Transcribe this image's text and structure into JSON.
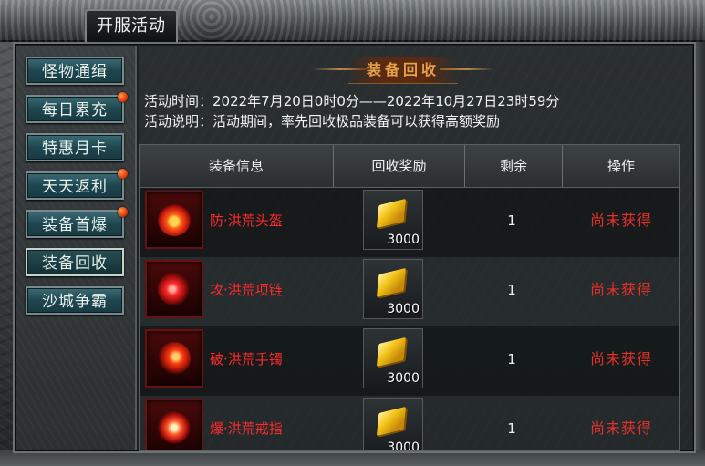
{
  "window": {
    "title": "开服活动"
  },
  "sidebar": {
    "items": [
      {
        "label": "怪物通缉",
        "badge": false,
        "active": false
      },
      {
        "label": "每日累充",
        "badge": true,
        "active": false
      },
      {
        "label": "特惠月卡",
        "badge": false,
        "active": false
      },
      {
        "label": "天天返利",
        "badge": true,
        "active": false
      },
      {
        "label": "装备首爆",
        "badge": true,
        "active": false
      },
      {
        "label": "装备回收",
        "badge": false,
        "active": true
      },
      {
        "label": "沙城争霸",
        "badge": false,
        "active": false
      }
    ]
  },
  "main": {
    "banner_title": "装备回收",
    "time_line": "活动时间：2022年7月20日0时0分——2022年10月27日23时59分",
    "desc_line": "活动说明：活动期间，率先回收极品装备可以获得高额奖励",
    "table": {
      "headers": [
        "装备信息",
        "回收奖励",
        "剩余",
        "操作"
      ],
      "rows": [
        {
          "name": "防·洪荒头盔",
          "icon": "helmet-icon",
          "reward": "3000",
          "remain": "1",
          "status": "尚未获得"
        },
        {
          "name": "攻·洪荒项链",
          "icon": "necklace-icon",
          "reward": "3000",
          "remain": "1",
          "status": "尚未获得"
        },
        {
          "name": "破·洪荒手镯",
          "icon": "bracelet-icon",
          "reward": "3000",
          "remain": "1",
          "status": "尚未获得"
        },
        {
          "name": "爆·洪荒戒指",
          "icon": "ring-icon",
          "reward": "3000",
          "remain": "1",
          "status": "尚未获得"
        }
      ]
    }
  },
  "colors": {
    "item_name": "#ff2a2a",
    "status_text": "#e8302a",
    "banner_text": "#e7a04a",
    "nav_bg": "#1f4650"
  }
}
